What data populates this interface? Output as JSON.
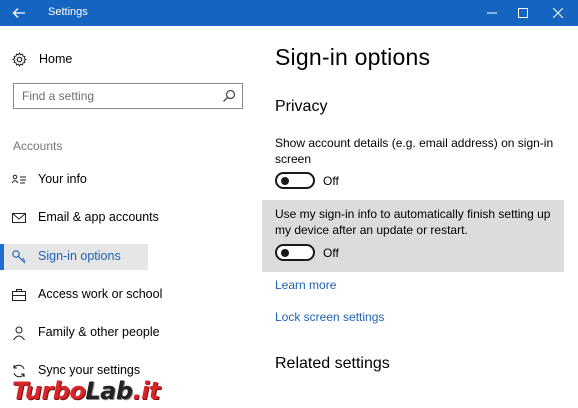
{
  "window": {
    "title": "Settings",
    "accent_color": "#1565c0"
  },
  "sidebar": {
    "home_label": "Home",
    "search_placeholder": "Find a setting",
    "section_label": "Accounts",
    "items": [
      {
        "label": "Your info",
        "icon": "contact-card-icon",
        "selected": false
      },
      {
        "label": "Email & app accounts",
        "icon": "mail-icon",
        "selected": false
      },
      {
        "label": "Sign-in options",
        "icon": "key-icon",
        "selected": true
      },
      {
        "label": "Access work or school",
        "icon": "briefcase-icon",
        "selected": false
      },
      {
        "label": "Family & other people",
        "icon": "person-icon",
        "selected": false
      },
      {
        "label": "Sync your settings",
        "icon": "sync-icon",
        "selected": false
      }
    ]
  },
  "main": {
    "title": "Sign-in options",
    "privacy_heading": "Privacy",
    "setting1_text": "Show account details (e.g. email address) on sign-in screen",
    "setting1_state": "Off",
    "setting2_text": "Use my sign-in info to automatically finish setting up my device after an update or restart.",
    "setting2_state": "Off",
    "learn_more": "Learn more",
    "lock_screen_link": "Lock screen settings",
    "related_heading": "Related settings"
  },
  "watermark": {
    "text_part1": "Turbo",
    "text_part2": "Lab",
    "text_part3": ".it"
  }
}
